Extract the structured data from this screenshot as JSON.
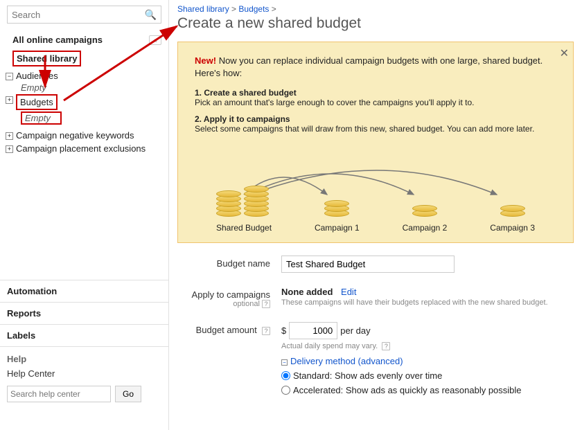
{
  "sidebar": {
    "search_placeholder": "Search",
    "all_campaigns": "All online campaigns",
    "shared_library": "Shared library",
    "tree": {
      "audiences": {
        "label": "Audiences",
        "empty": "Empty"
      },
      "budgets": {
        "label": "Budgets",
        "empty": "Empty"
      },
      "neg_keywords": {
        "label": "Campaign negative keywords"
      },
      "placement_excl": {
        "label": "Campaign placement exclusions"
      }
    },
    "sections": {
      "automation": "Automation",
      "reports": "Reports",
      "labels": "Labels"
    },
    "help": {
      "heading": "Help",
      "center": "Help Center",
      "search_placeholder": "Search help center",
      "go": "Go"
    }
  },
  "breadcrumb": {
    "a": "Shared library",
    "b": "Budgets"
  },
  "page_title": "Create a new shared budget",
  "notice": {
    "new_label": "New!",
    "intro": "Now you can replace individual campaign budgets with one large, shared budget. Here's how:",
    "step1_t": "1. Create a shared budget",
    "step1_b": "Pick an amount that's large enough to cover the campaigns you'll apply it to.",
    "step2_t": "2. Apply it to campaigns",
    "step2_b": "Select some campaigns that will draw from this new, shared budget. You can add more later.",
    "labels": {
      "shared": "Shared Budget",
      "c1": "Campaign 1",
      "c2": "Campaign 2",
      "c3": "Campaign 3"
    }
  },
  "form": {
    "budget_name": {
      "label": "Budget name",
      "value": "Test Shared Budget"
    },
    "apply": {
      "label": "Apply to campaigns",
      "optional": "optional",
      "none": "None added",
      "edit": "Edit",
      "hint": "These campaigns will have their budgets replaced with the new shared budget."
    },
    "amount": {
      "label": "Budget amount",
      "currency": "$",
      "value": "1000",
      "per": "per day",
      "hint": "Actual daily spend may vary.",
      "delivery": "Delivery method (advanced)",
      "standard": "Standard: Show ads evenly over time",
      "accel": "Accelerated: Show ads as quickly as reasonably possible"
    }
  }
}
